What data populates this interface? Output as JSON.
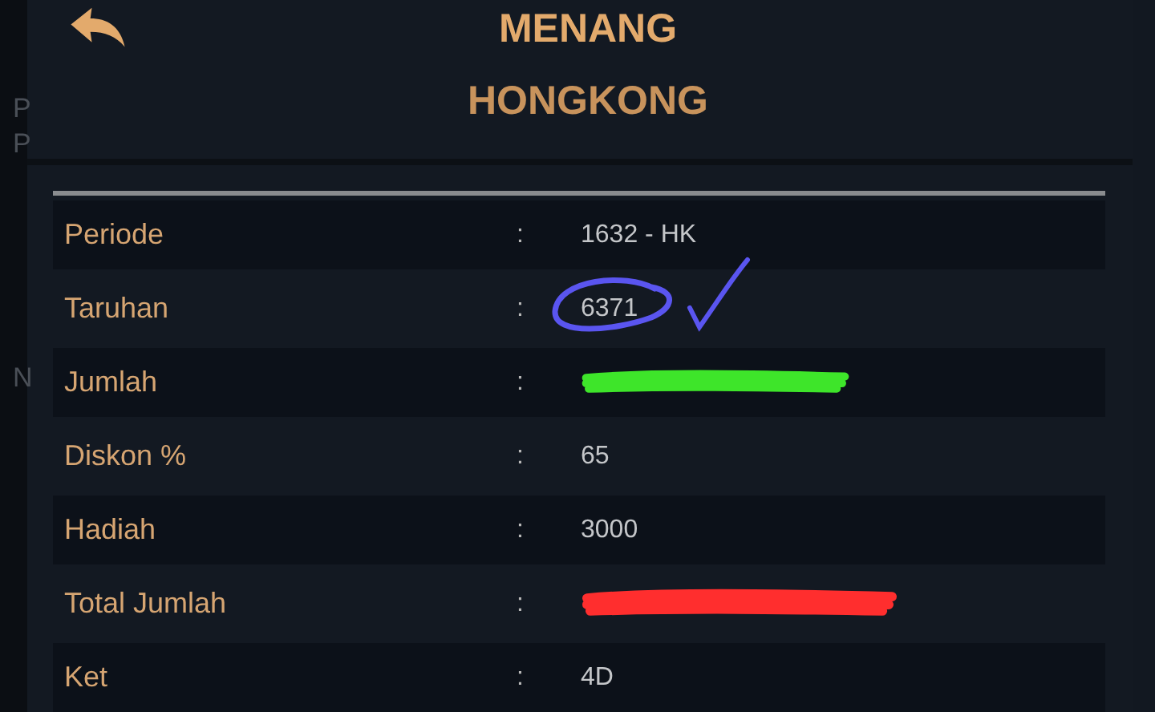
{
  "background_letters": [
    "P",
    "P",
    "N"
  ],
  "header": {
    "title": "MENANG",
    "subtitle": "HONGKONG"
  },
  "rows": [
    {
      "label": "Periode",
      "separator": ":",
      "value": "1632 - HK"
    },
    {
      "label": "Taruhan",
      "separator": ":",
      "value": "6371",
      "annotation": {
        "kind": "circle-check",
        "color": "#5a55f0"
      }
    },
    {
      "label": "Jumlah",
      "separator": ":",
      "redaction": {
        "color": "#3ee52a"
      }
    },
    {
      "label": "Diskon %",
      "separator": ":",
      "value": "65"
    },
    {
      "label": "Hadiah",
      "separator": ":",
      "value": "3000"
    },
    {
      "label": "Total Jumlah",
      "separator": ":",
      "redaction": {
        "color": "#ff2e2e"
      }
    },
    {
      "label": "Ket",
      "separator": ":",
      "value": "4D"
    }
  ]
}
